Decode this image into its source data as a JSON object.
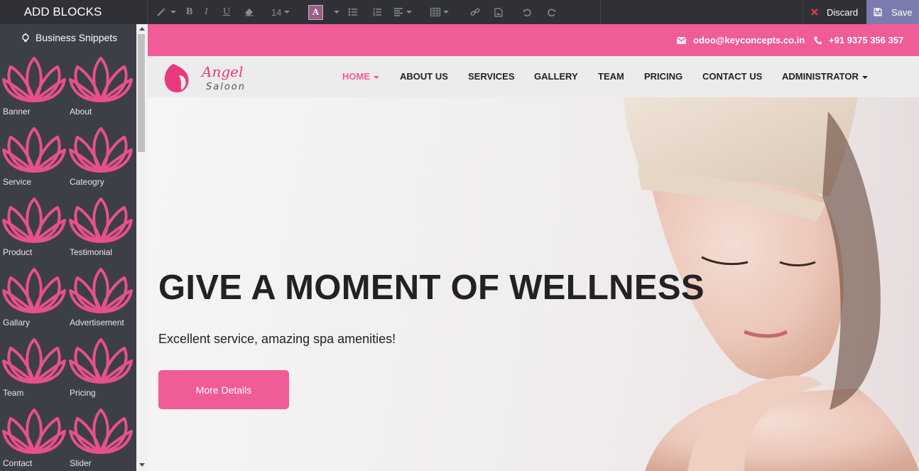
{
  "editor": {
    "add_blocks_title": "ADD BLOCKS",
    "font_size": "14",
    "discard_label": "Discard",
    "save_label": "Save",
    "tools": [
      "magic-wand-icon",
      "bold-icon",
      "italic-icon",
      "underline-icon",
      "eraser-icon",
      "font-size",
      "text-color-icon",
      "unordered-list-icon",
      "ordered-list-icon",
      "align-icon",
      "table-icon",
      "link-icon",
      "image-icon",
      "undo-icon",
      "redo-icon"
    ]
  },
  "sidebar": {
    "header": "Business Snippets",
    "snippets": [
      {
        "label": "Banner"
      },
      {
        "label": "About"
      },
      {
        "label": "Service"
      },
      {
        "label": "Cateogry"
      },
      {
        "label": "Product"
      },
      {
        "label": "Testimonial"
      },
      {
        "label": "Gallary"
      },
      {
        "label": "Advertisement"
      },
      {
        "label": "Team"
      },
      {
        "label": "Pricing"
      },
      {
        "label": "Contact"
      },
      {
        "label": "Slider"
      }
    ],
    "snippet_icon": "lotus-icon"
  },
  "site": {
    "email": "odoo@keyconcepts.co.in",
    "phone": "+91 9375 356 357",
    "logo": {
      "line1": "Angel",
      "line2": "Saloon"
    },
    "nav": [
      {
        "label": "HOME",
        "active": true,
        "dropdown": true
      },
      {
        "label": "ABOUT US"
      },
      {
        "label": "SERVICES"
      },
      {
        "label": "GALLERY"
      },
      {
        "label": "TEAM"
      },
      {
        "label": "PRICING"
      },
      {
        "label": "CONTACT US"
      },
      {
        "label": "ADMINISTRATOR",
        "dropdown": true
      }
    ],
    "hero": {
      "title": "GIVE A MOMENT OF WELLNESS",
      "subtitle": "Excellent service, amazing spa amenities!",
      "button": "More Details"
    }
  },
  "colors": {
    "brand_pink": "#f05c97",
    "toolbar_dark": "#2f3136",
    "sidebar_dark": "#3c3f45",
    "save_purple": "#7c7bad"
  }
}
